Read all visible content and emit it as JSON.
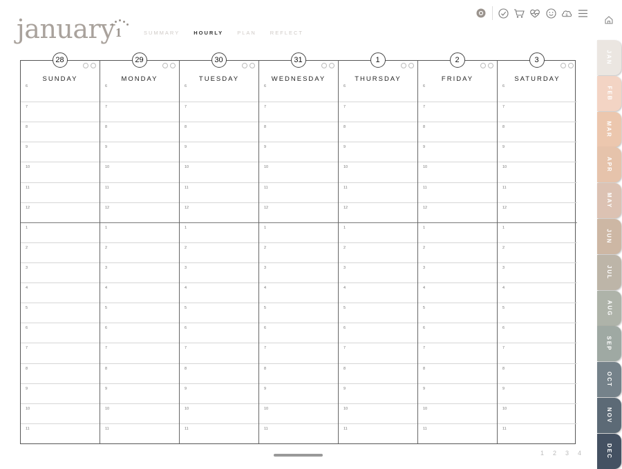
{
  "header": {
    "month": "january",
    "week_number": "1"
  },
  "view_tabs": [
    {
      "label": "SUMMARY",
      "active": false
    },
    {
      "label": "HOURLY",
      "active": true
    },
    {
      "label": "PLAN",
      "active": false
    },
    {
      "label": "REFLECT",
      "active": false
    }
  ],
  "toolbar": {
    "icons": [
      "settings-badge-icon",
      "check-circle-icon",
      "cart-icon",
      "heart-pulse-icon",
      "smiley-icon",
      "money-cloud-icon",
      "menu-icon"
    ]
  },
  "days": [
    {
      "name": "SUNDAY",
      "date": "28"
    },
    {
      "name": "MONDAY",
      "date": "29"
    },
    {
      "name": "TUESDAY",
      "date": "30"
    },
    {
      "name": "WEDNESDAY",
      "date": "31"
    },
    {
      "name": "THURSDAY",
      "date": "1"
    },
    {
      "name": "FRIDAY",
      "date": "2"
    },
    {
      "name": "SATURDAY",
      "date": "3"
    }
  ],
  "hours": [
    "6",
    "7",
    "8",
    "9",
    "10",
    "11",
    "12",
    "1",
    "2",
    "3",
    "4",
    "5",
    "6",
    "7",
    "8",
    "9",
    "10",
    "11"
  ],
  "month_tabs": [
    {
      "label": "JAN",
      "color": "#ebe6e1",
      "text_color": "#ffffff"
    },
    {
      "label": "FEB",
      "color": "#f3d4c4",
      "text_color": "#ffffff"
    },
    {
      "label": "MAR",
      "color": "#ecc7ae",
      "text_color": "#ffffff"
    },
    {
      "label": "APR",
      "color": "#e6c3ab",
      "text_color": "#ffffff"
    },
    {
      "label": "MAY",
      "color": "#dcc2b3",
      "text_color": "#ffffff"
    },
    {
      "label": "JUN",
      "color": "#cdb7a4",
      "text_color": "#ffffff"
    },
    {
      "label": "JUL",
      "color": "#bdb5a8",
      "text_color": "#ffffff"
    },
    {
      "label": "AUG",
      "color": "#aeb3a9",
      "text_color": "#ffffff"
    },
    {
      "label": "SEP",
      "color": "#9fa9a3",
      "text_color": "#ffffff"
    },
    {
      "label": "OCT",
      "color": "#75828a",
      "text_color": "#ffffff"
    },
    {
      "label": "NOV",
      "color": "#5c6a76",
      "text_color": "#ffffff"
    },
    {
      "label": "DEC",
      "color": "#445162",
      "text_color": "#ffffff"
    }
  ],
  "pager": [
    "1",
    "2",
    "3",
    "4"
  ]
}
